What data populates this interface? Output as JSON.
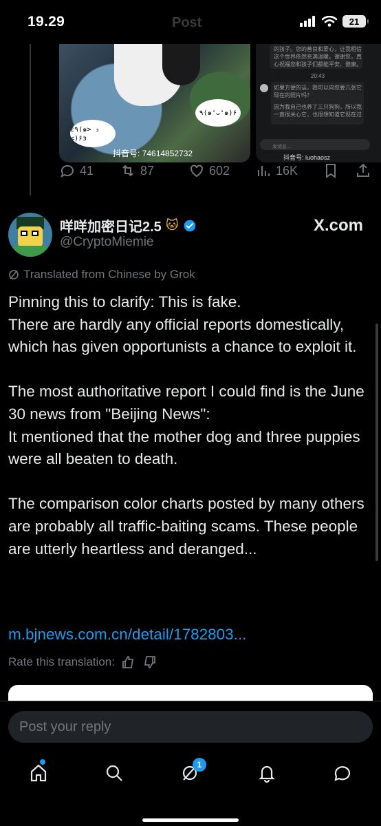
{
  "status_bar": {
    "time": "19.29",
    "screen_title": "Post",
    "battery": "21"
  },
  "previous_post": {
    "media": [
      {
        "watermark": "抖音号: 74614852732",
        "sticker_left": "ε٩(๑> ₃ <)۶з",
        "sticker_right": "٩(๑❛ᴗ❛๑)۶"
      },
      {
        "watermark": "抖音号: luohaosz",
        "chat_lines": [
          "的孩子。您的善良和爱心，让我相信",
          "这个世界依然充满温暖。谢谢您，真",
          "心祝福您和孩子们都能平安、健康。",
          "如果方便的话，我可以向您要几张它",
          "现在的照片吗？",
          "因为我自己也养了三只狗狗，所以我",
          "一直很关心它，也很想知道它现在过"
        ],
        "chat_time": "20:43",
        "input_placeholder": "发消息..."
      }
    ],
    "actions": {
      "replies": "41",
      "reposts": "87",
      "likes": "602",
      "views": "16K"
    }
  },
  "post": {
    "author_name": "咩咩加密日记2.5",
    "author_emoji": "🐱",
    "author_handle": "@CryptoMiemie",
    "source_brand": "X.com",
    "translated_label": "Translated from Chinese by Grok",
    "text": "Pinning this to clarify: This is fake.\nThere are hardly any official reports domestically, which has given opportunists a chance to exploit it.\n\nThe most authoritative report I could find is the June 30 news from \"Beijing News\":\nIt mentioned that the mother dog and three puppies were all beaten to death.\n\nThe comparison color charts posted by many others are probably all traffic-baiting scams. These people are utterly heartless and deranged...",
    "link": "m.bjnews.com.cn/detail/1782803...",
    "rate_label": "Rate this translation:"
  },
  "reply": {
    "placeholder": "Post your reply"
  },
  "tabbar": {
    "messages_badge": "1"
  },
  "colors": {
    "accent": "#1d9bf0",
    "background": "#000000",
    "muted": "#71767b"
  }
}
